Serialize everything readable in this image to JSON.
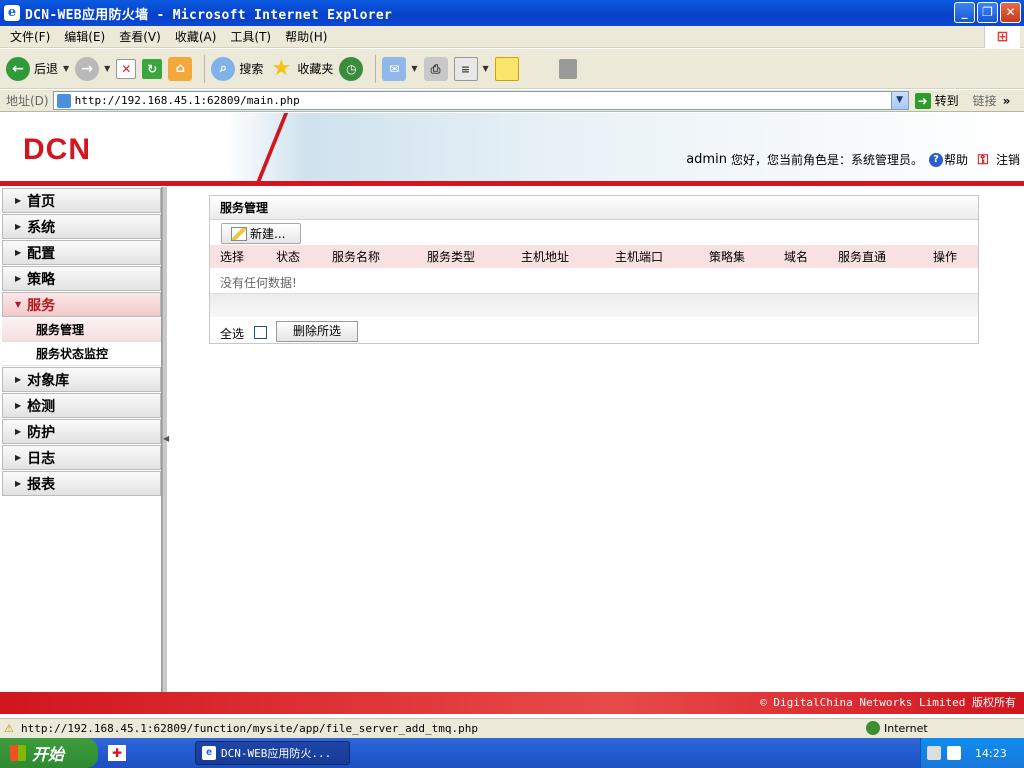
{
  "window": {
    "title": "DCN-WEB应用防火墙 - Microsoft Internet Explorer",
    "buttons": [
      "_",
      "❐",
      "✕"
    ]
  },
  "menu": [
    "文件(F)",
    "编辑(E)",
    "查看(V)",
    "收藏(A)",
    "工具(T)",
    "帮助(H)"
  ],
  "toolbar": {
    "back": "后退",
    "search": "搜索",
    "favorites": "收藏夹"
  },
  "address": {
    "label": "地址(D)",
    "url": "http://192.168.45.1:62809/main.php",
    "go": "转到",
    "links": "链接"
  },
  "header": {
    "logo": "DCN",
    "user": "admin",
    "greeting": "您好，您当前角色是：系统管理员。",
    "help": "帮助",
    "logout": "注销"
  },
  "sidebar": {
    "items": [
      {
        "label": "首页"
      },
      {
        "label": "系统"
      },
      {
        "label": "配置"
      },
      {
        "label": "策略"
      },
      {
        "label": "服务"
      },
      {
        "label": "对象库"
      },
      {
        "label": "检测"
      },
      {
        "label": "防护"
      },
      {
        "label": "日志"
      },
      {
        "label": "报表"
      }
    ],
    "sub": [
      {
        "label": "服务管理"
      },
      {
        "label": "服务状态监控"
      }
    ]
  },
  "panel": {
    "title": "服务管理",
    "new_button": "新建...",
    "columns": [
      "选择",
      "状态",
      "服务名称",
      "服务类型",
      "主机地址",
      "主机端口",
      "策略集",
      "域名",
      "服务直通",
      "操作"
    ],
    "empty": "没有任何数据!",
    "select_all": "全选",
    "delete_button": "删除所选"
  },
  "footer": {
    "copyright": "© DigitalChina Networks Limited 版权所有"
  },
  "statusbar": {
    "url": "http://192.168.45.1:62809/function/mysite/app/file_server_add_tmq.php",
    "zone": "Internet"
  },
  "taskbar": {
    "start": "开始",
    "task": "DCN-WEB应用防火...",
    "time": "14:23"
  },
  "colors": {
    "brand_red": "#d2151f",
    "xp_blue": "#0a5ae0",
    "table_header": "#f9e1e1"
  }
}
